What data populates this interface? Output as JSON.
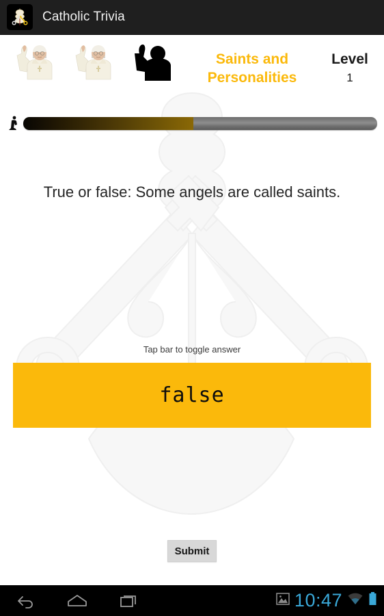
{
  "appbar": {
    "title": "Catholic Trivia",
    "icon": "papal-tiara-keys-icon"
  },
  "header": {
    "category": "Saints and Personalities",
    "level_label": "Level",
    "level_value": "1",
    "lives": [
      {
        "state": "alive",
        "icon": "pope-waving-photo"
      },
      {
        "state": "alive",
        "icon": "pope-waving-photo"
      },
      {
        "state": "lost",
        "icon": "pope-waving-silhouette"
      }
    ]
  },
  "progress": {
    "marker_icon": "runner-marker-icon",
    "percent": 48,
    "fill_color": "#7a5d06",
    "track_color": "#8e8e8e"
  },
  "quiz": {
    "question": "True or false: Some angels are called saints.",
    "toggle_hint": "Tap bar to toggle answer",
    "answer": "false",
    "answer_bar_color": "#fbb90b",
    "submit_label": "Submit"
  },
  "navbar": {
    "back_icon": "back-arrow-icon",
    "home_icon": "home-icon",
    "recents_icon": "recent-apps-icon",
    "screenshot_icon": "image-icon",
    "time": "10:47",
    "wifi_icon": "wifi-icon",
    "battery_icon": "battery-full-icon",
    "accent_color": "#3aa8d8"
  },
  "theme": {
    "accent": "#fbb90b",
    "appbar_bg": "#1f1f1f",
    "page_bg": "#ffffff"
  }
}
